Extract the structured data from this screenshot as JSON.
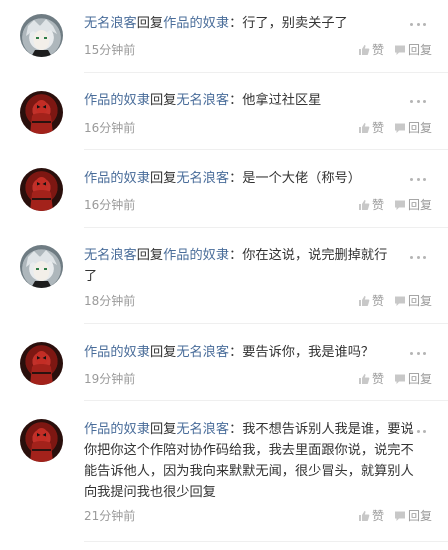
{
  "comments": [
    {
      "avatar": "anime-character-avatar",
      "author": "无名浪客",
      "action": "回复",
      "target": "作品的奴隶",
      "body": "：行了，别卖关子了",
      "time": "15分钟前",
      "like_label": "赞",
      "reply_label": "回复"
    },
    {
      "avatar": "deadpool-avatar",
      "author": "作品的奴隶",
      "action": "回复",
      "target": "无名浪客",
      "body": "：他拿过社区星",
      "time": "16分钟前",
      "like_label": "赞",
      "reply_label": "回复"
    },
    {
      "avatar": "deadpool-avatar",
      "author": "作品的奴隶",
      "action": "回复",
      "target": "无名浪客",
      "body": "：是一个大佬（称号）",
      "time": "16分钟前",
      "like_label": "赞",
      "reply_label": "回复"
    },
    {
      "avatar": "anime-character-avatar",
      "author": "无名浪客",
      "action": "回复",
      "target": "作品的奴隶",
      "body": "：你在这说，说完删掉就行了",
      "time": "18分钟前",
      "like_label": "赞",
      "reply_label": "回复"
    },
    {
      "avatar": "deadpool-avatar",
      "author": "作品的奴隶",
      "action": "回复",
      "target": "无名浪客",
      "body": "：要告诉你，我是谁吗？",
      "time": "19分钟前",
      "like_label": "赞",
      "reply_label": "回复"
    },
    {
      "avatar": "deadpool-avatar",
      "author": "作品的奴隶",
      "action": "回复",
      "target": "无名浪客",
      "body": "：我不想告诉别人我是谁，要说你把你这个作陪对协作码给我，我去里面跟你说，说完不能告诉他人，因为我向来默默无闻，很少冒头，就算别人向我提问我也很少回复",
      "time": "21分钟前",
      "like_label": "赞",
      "reply_label": "回复"
    }
  ]
}
